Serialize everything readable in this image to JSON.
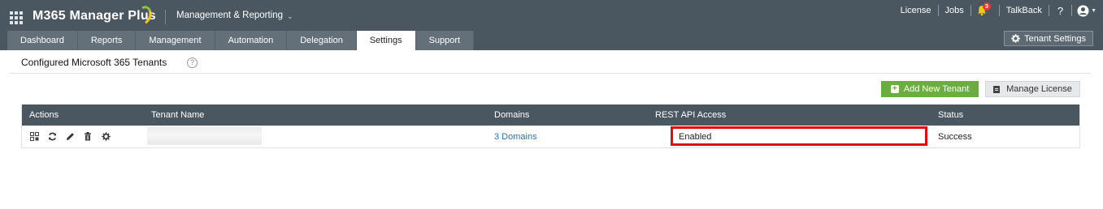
{
  "app": {
    "title": "M365 Manager Plus",
    "menu": "Management & Reporting"
  },
  "topbar": {
    "license": "License",
    "jobs": "Jobs",
    "notification_count": "3",
    "talkback": "TalkBack",
    "help": "?"
  },
  "tabs": [
    {
      "label": "Dashboard",
      "active": false
    },
    {
      "label": "Reports",
      "active": false
    },
    {
      "label": "Management",
      "active": false
    },
    {
      "label": "Automation",
      "active": false
    },
    {
      "label": "Delegation",
      "active": false
    },
    {
      "label": "Settings",
      "active": true
    },
    {
      "label": "Support",
      "active": false
    }
  ],
  "tenant_settings_label": "Tenant Settings",
  "page": {
    "title": "Configured Microsoft 365 Tenants",
    "help": "?"
  },
  "buttons": {
    "add_tenant": "Add New Tenant",
    "manage_license": "Manage License"
  },
  "table": {
    "columns": [
      "Actions",
      "Tenant Name",
      "Domains",
      "REST API Access",
      "Status"
    ],
    "rows": [
      {
        "tenant_name": "",
        "domains": "3 Domains",
        "rest_api_access": "Enabled",
        "status": "Success"
      }
    ]
  },
  "colors": {
    "header_bg": "#4a5760",
    "tab_bg": "#637079",
    "add_button": "#6aaf3d",
    "highlight": "#e4090a",
    "link": "#2a75b8"
  }
}
